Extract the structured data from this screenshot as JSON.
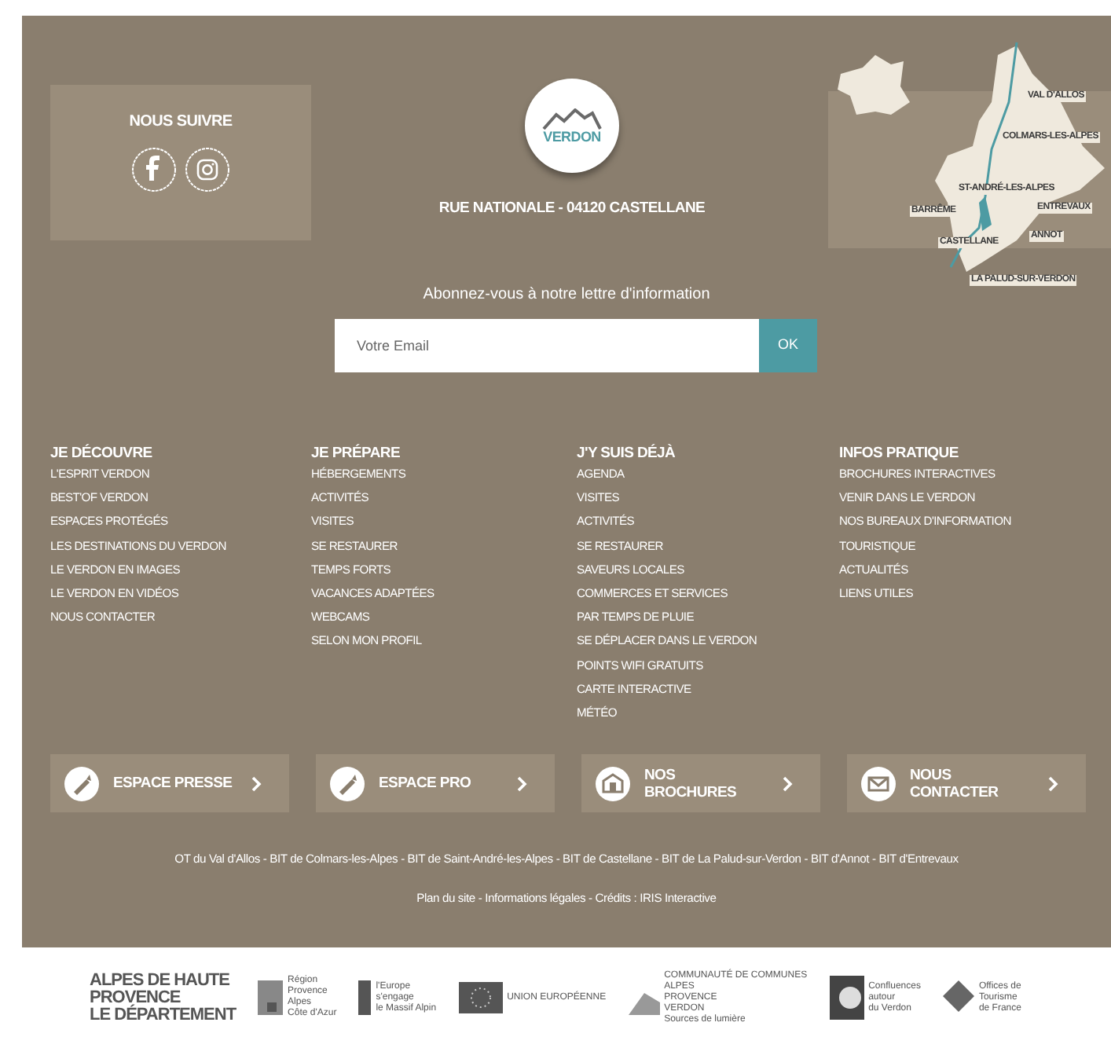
{
  "social": {
    "title": "NOUS SUIVRE",
    "networks": [
      {
        "kind": "facebook"
      },
      {
        "kind": "instagram"
      }
    ]
  },
  "brand": {
    "logo_text": "VERDON",
    "address": "RUE NATIONALE - 04120 CASTELLANE"
  },
  "newsletter": {
    "label": "Abonnez-vous à notre lettre d'information",
    "placeholder": "Votre Email",
    "button": "OK"
  },
  "map": {
    "places": [
      "VAL D'ALLOS",
      "COLMARS-LES-ALPES",
      "ST-ANDRÉ-LES-ALPES",
      "BARRÊME",
      "ENTREVAUX",
      "ANNOT",
      "CASTELLANE",
      "LA PALUD-SUR-VERDON"
    ]
  },
  "columns": [
    {
      "title": "JE DÉCOUVRE",
      "links": [
        "L'ESPRIT VERDON",
        "BEST'OF VERDON",
        "ESPACES PROTÉGÉS",
        "LES DESTINATIONS DU VERDON",
        "LE VERDON EN IMAGES",
        "LE VERDON EN VIDÉOS",
        "NOUS CONTACTER"
      ]
    },
    {
      "title": "JE PRÉPARE",
      "links": [
        "HÉBERGEMENTS",
        "ACTIVITÉS",
        "VISITES",
        "SE RESTAURER",
        "TEMPS FORTS",
        "VACANCES ADAPTÉES",
        "WEBCAMS",
        "SELON MON PROFIL"
      ]
    },
    {
      "title": "J'Y SUIS DÉJÀ",
      "links": [
        "AGENDA",
        "VISITES",
        "ACTIVITÉS",
        "SE RESTAURER",
        "SAVEURS LOCALES",
        "COMMERCES ET SERVICES",
        "PAR TEMPS DE PLUIE",
        "SE DÉPLACER DANS LE VERDON",
        "POINTS WIFI GRATUITS",
        "CARTE INTERACTIVE",
        "MÉTÉO"
      ]
    },
    {
      "title": "INFOS PRATIQUE",
      "links": [
        "BROCHURES INTERACTIVES",
        "VENIR DANS LE VERDON",
        "NOS BUREAUX D'INFORMATION",
        "TOURISTIQUE",
        "ACTUALITÉS",
        "LIENS UTILES"
      ]
    }
  ],
  "tiles": [
    {
      "label": "ESPACE PRESSE",
      "kind": "pen"
    },
    {
      "label": "ESPACE PRO",
      "kind": "pen"
    },
    {
      "label": "NOS BROCHURES",
      "kind": "brochure"
    },
    {
      "label": "NOUS CONTACTER",
      "kind": "mail"
    }
  ],
  "offices": "OT du Val d'Allos - BIT de Colmars-les-Alpes - BIT de Saint-André-les-Alpes - BIT de Castellane - BIT de La Palud-sur-Verdon - BIT d'Annot - BIT d'Entrevaux",
  "legal": "Plan du site - Informations légales - Crédits : IRIS Interactive",
  "partners": [
    {
      "kind": "department",
      "lines": [
        "ALPES DE HAUTE",
        "PROVENCE",
        "LE DÉPARTEMENT"
      ]
    },
    {
      "kind": "region",
      "lines": [
        "Région",
        "Provence",
        "Alpes",
        "Côte d'Azur"
      ]
    },
    {
      "kind": "europe-engage",
      "lines": [
        "l'Europe",
        "s'engage",
        "le Massif Alpin"
      ]
    },
    {
      "kind": "eu",
      "lines": [
        "UNION EUROPÉENNE"
      ]
    },
    {
      "kind": "community",
      "lines": [
        "COMMUNAUTÉ DE COMMUNES",
        "ALPES",
        "PROVENCE",
        "VERDON",
        "Sources de lumière"
      ]
    },
    {
      "kind": "leader",
      "lines": [
        "Confluences",
        "autour",
        "du Verdon"
      ]
    },
    {
      "kind": "offices",
      "lines": [
        "Offices de",
        "Tourisme",
        "de France"
      ]
    }
  ]
}
